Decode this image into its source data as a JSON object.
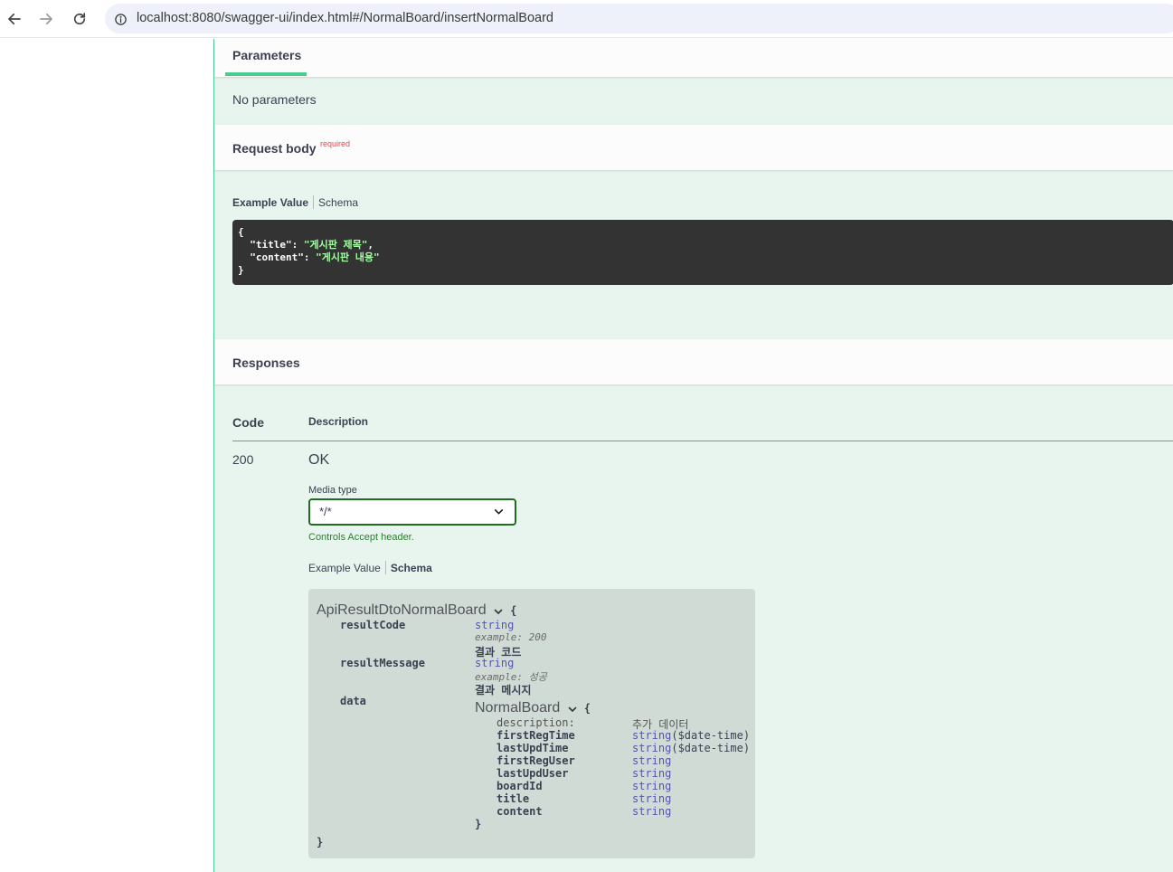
{
  "browser": {
    "url": "localhost:8080/swagger-ui/index.html#/NormalBoard/insertNormalBoard"
  },
  "parameters": {
    "tab_label": "Parameters",
    "empty_text": "No parameters"
  },
  "request_body": {
    "title": "Request body",
    "required_label": "required",
    "tabs": {
      "example": "Example Value",
      "schema": "Schema"
    },
    "example_lines": {
      "open": "{",
      "title_key": "  \"title\": ",
      "title_val": "\"게시판 제목\"",
      "comma": ",",
      "content_key": "  \"content\": ",
      "content_val": "\"게시판 내용\"",
      "close": "}"
    }
  },
  "responses": {
    "title": "Responses",
    "columns": {
      "code": "Code",
      "description": "Description"
    },
    "items": [
      {
        "code": "200",
        "description": "OK",
        "media_type_label": "Media type",
        "media_type_value": "*/*",
        "controls_note": "Controls Accept header.",
        "tabs": {
          "example": "Example Value",
          "schema": "Schema"
        },
        "schema": {
          "model_name": "ApiResultDtoNormalBoard",
          "open_brace": "{",
          "close_brace": "}",
          "properties": [
            {
              "name": "resultCode",
              "type": "string",
              "example_label": "example:",
              "example_value": "200",
              "description": "결과 코드"
            },
            {
              "name": "resultMessage",
              "type": "string",
              "example_label": "example:",
              "example_value": "성공",
              "description": "결과 메시지"
            },
            {
              "name": "data"
            }
          ],
          "nested": {
            "model_name": "NormalBoard",
            "open_brace": "{",
            "close_brace": "}",
            "description_label": "description:",
            "description_value": "추가 데이터",
            "properties": [
              {
                "name": "firstRegTime",
                "type": "string",
                "format": "($date-time)"
              },
              {
                "name": "lastUpdTime",
                "type": "string",
                "format": "($date-time)"
              },
              {
                "name": "firstRegUser",
                "type": "string"
              },
              {
                "name": "lastUpdUser",
                "type": "string"
              },
              {
                "name": "boardId",
                "type": "string"
              },
              {
                "name": "title",
                "type": "string"
              },
              {
                "name": "content",
                "type": "string"
              }
            ]
          }
        }
      }
    ]
  }
}
